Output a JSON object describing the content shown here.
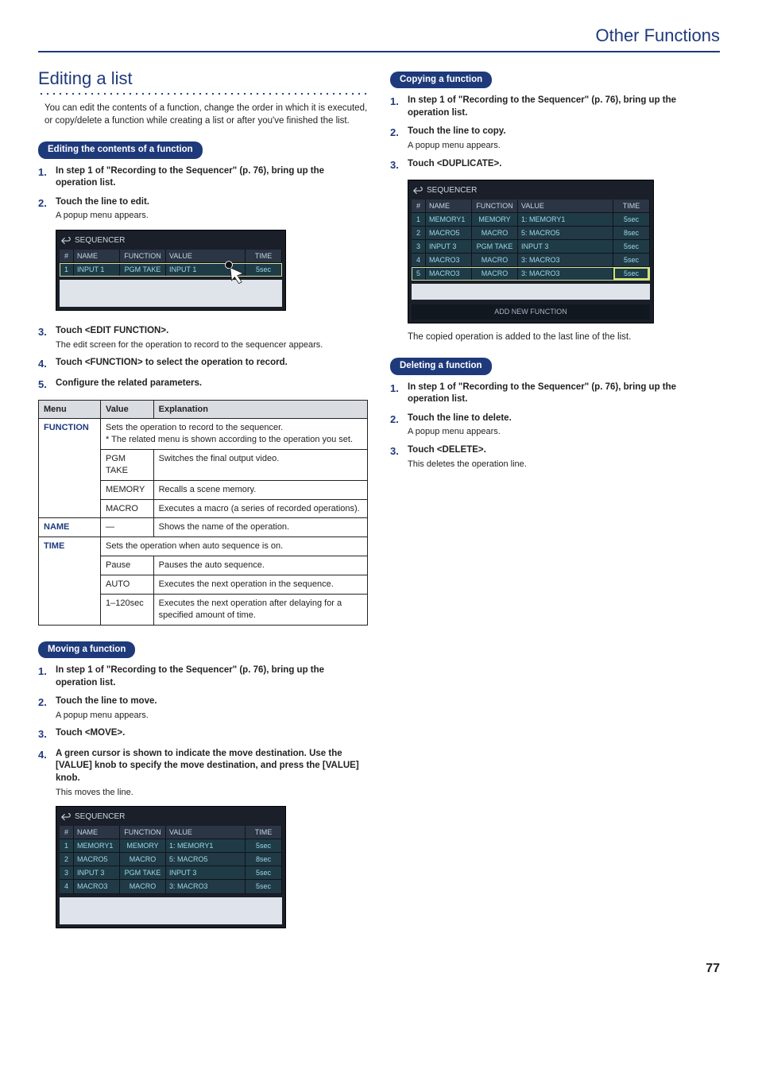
{
  "header": {
    "category": "Other Functions"
  },
  "page_number": "77",
  "section_title": "Editing a list",
  "intro": "You can edit the contents of a function, change the order in which it is executed, or copy/delete a function while creating a list or after you've finished the list.",
  "edit_contents": {
    "heading": "Editing the contents of a function",
    "steps": [
      {
        "n": "1.",
        "main": "In step 1 of \"Recording to the Sequencer\" (p. 76), bring up the operation list."
      },
      {
        "n": "2.",
        "main": "Touch the line to edit.",
        "sub": "A popup menu appears."
      },
      {
        "n": "3.",
        "main": "Touch <EDIT FUNCTION>.",
        "sub": "The edit screen for the operation to record to the sequencer appears."
      },
      {
        "n": "4.",
        "main": "Touch <FUNCTION> to select the operation to record."
      },
      {
        "n": "5.",
        "main": "Configure the related parameters."
      }
    ],
    "seq_shot": {
      "title": "SEQUENCER",
      "headers": {
        "idx": "#",
        "name": "NAME",
        "func": "FUNCTION",
        "value": "VALUE",
        "time": "TIME"
      },
      "rows": [
        {
          "idx": "1",
          "name": "INPUT 1",
          "func": "PGM TAKE",
          "value": "INPUT 1",
          "time": "5sec"
        }
      ]
    }
  },
  "param_table": {
    "headers": {
      "menu": "Menu",
      "value": "Value",
      "explanation": "Explanation"
    },
    "function_note": "Sets the operation to record to the sequencer.\n*  The related menu is shown according to the operation you set.",
    "rows_function": [
      {
        "menu": "FUNCTION",
        "value": "PGM TAKE",
        "exp": "Switches the final output video."
      },
      {
        "value": "MEMORY",
        "exp": "Recalls a scene memory."
      },
      {
        "value": "MACRO",
        "exp": "Executes a macro (a series of recorded operations)."
      }
    ],
    "row_name": {
      "menu": "NAME",
      "value": "—",
      "exp": "Shows the name of the operation."
    },
    "time_note": "Sets the operation when auto sequence is on.",
    "rows_time": [
      {
        "menu": "TIME",
        "value": "Pause",
        "exp": "Pauses the auto sequence."
      },
      {
        "value": "AUTO",
        "exp": "Executes the next operation in the sequence."
      },
      {
        "value": "1–120sec",
        "exp": "Executes the next operation after delaying for a specified amount of time."
      }
    ]
  },
  "moving": {
    "heading": "Moving a function",
    "steps": [
      {
        "n": "1.",
        "main": "In step 1 of \"Recording to the Sequencer\" (p. 76), bring up the operation list."
      },
      {
        "n": "2.",
        "main": "Touch the line to move.",
        "sub": "A popup menu appears."
      },
      {
        "n": "3.",
        "main": "Touch <MOVE>."
      },
      {
        "n": "4.",
        "main": "A green cursor is shown to indicate the move destination. Use the [VALUE] knob to specify the move destination, and press the [VALUE] knob.",
        "sub": "This moves the line."
      }
    ],
    "seq_shot": {
      "title": "SEQUENCER",
      "headers": {
        "idx": "#",
        "name": "NAME",
        "func": "FUNCTION",
        "value": "VALUE",
        "time": "TIME"
      },
      "rows": [
        {
          "idx": "1",
          "name": "MEMORY1",
          "func": "MEMORY",
          "value": "1: MEMORY1",
          "time": "5sec"
        },
        {
          "idx": "2",
          "name": "MACRO5",
          "func": "MACRO",
          "value": "5: MACRO5",
          "time": "8sec"
        },
        {
          "idx": "3",
          "name": "INPUT 3",
          "func": "PGM TAKE",
          "value": "INPUT 3",
          "time": "5sec"
        },
        {
          "idx": "4",
          "name": "MACRO3",
          "func": "MACRO",
          "value": "3: MACRO3",
          "time": "5sec"
        }
      ]
    }
  },
  "copying": {
    "heading": "Copying a function",
    "steps": [
      {
        "n": "1.",
        "main": "In step 1 of \"Recording to the Sequencer\" (p. 76), bring up the operation list."
      },
      {
        "n": "2.",
        "main": "Touch the line to copy.",
        "sub": "A popup menu appears."
      },
      {
        "n": "3.",
        "main": "Touch <DUPLICATE>."
      }
    ],
    "seq_shot": {
      "title": "SEQUENCER",
      "headers": {
        "idx": "#",
        "name": "NAME",
        "func": "FUNCTION",
        "value": "VALUE",
        "time": "TIME"
      },
      "rows": [
        {
          "idx": "1",
          "name": "MEMORY1",
          "func": "MEMORY",
          "value": "1: MEMORY1",
          "time": "5sec"
        },
        {
          "idx": "2",
          "name": "MACRO5",
          "func": "MACRO",
          "value": "5: MACRO5",
          "time": "8sec"
        },
        {
          "idx": "3",
          "name": "INPUT 3",
          "func": "PGM TAKE",
          "value": "INPUT 3",
          "time": "5sec"
        },
        {
          "idx": "4",
          "name": "MACRO3",
          "func": "MACRO",
          "value": "3: MACRO3",
          "time": "5sec"
        },
        {
          "idx": "5",
          "name": "MACRO3",
          "func": "MACRO",
          "value": "3: MACRO3",
          "time": "5sec"
        }
      ],
      "footer": "ADD NEW FUNCTION"
    },
    "after": "The copied operation is added to the last line of the list."
  },
  "deleting": {
    "heading": "Deleting a function",
    "steps": [
      {
        "n": "1.",
        "main": "In step 1 of \"Recording to the Sequencer\" (p. 76), bring up the operation list."
      },
      {
        "n": "2.",
        "main": "Touch the line to delete.",
        "sub": "A popup menu appears."
      },
      {
        "n": "3.",
        "main": "Touch <DELETE>.",
        "sub": "This deletes the operation line."
      }
    ]
  }
}
